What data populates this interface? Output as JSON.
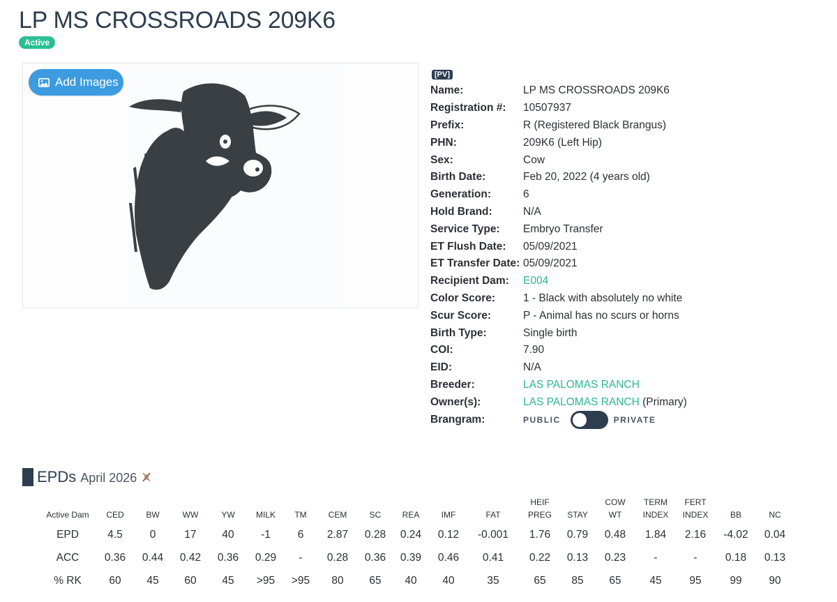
{
  "header": {
    "title": "LP MS CROSSROADS 209K6",
    "status": "Active"
  },
  "photo": {
    "add_images_label": "Add Images"
  },
  "pv_tag": "[PV]",
  "details": [
    {
      "label": "Name:",
      "value": "LP MS CROSSROADS 209K6"
    },
    {
      "label": "Registration #:",
      "value": "10507937"
    },
    {
      "label": "Prefix:",
      "value": "R (Registered Black Brangus)"
    },
    {
      "label": "PHN:",
      "value": "209K6 (Left Hip)"
    },
    {
      "label": "Sex:",
      "value": "Cow"
    },
    {
      "label": "Birth Date:",
      "value": "Feb 20, 2022 (4 years old)"
    },
    {
      "label": "Generation:",
      "value": "6"
    },
    {
      "label": "Hold Brand:",
      "value": "N/A"
    },
    {
      "label": "Service Type:",
      "value": "Embryo Transfer"
    },
    {
      "label": "ET Flush Date:",
      "value": "05/09/2021"
    },
    {
      "label": "ET Transfer Date:",
      "value": "05/09/2021"
    },
    {
      "label": "Recipient Dam:",
      "value": "E004"
    },
    {
      "label": "Color Score:",
      "value": "1 - Black with absolutely no white"
    },
    {
      "label": "Scur Score:",
      "value": "P - Animal has no scurs or horns"
    },
    {
      "label": "Birth Type:",
      "value": "Single birth"
    },
    {
      "label": "COI:",
      "value": "7.90"
    },
    {
      "label": "EID:",
      "value": "N/A"
    },
    {
      "label": "Breeder:",
      "value": "LAS PALOMAS RANCH"
    },
    {
      "label": "Owner(s):",
      "value": "LAS PALOMAS RANCH",
      "suffix": " (Primary)"
    },
    {
      "label": "Brangram:",
      "public": "PUBLIC",
      "private": "PRIVATE"
    }
  ],
  "epds": {
    "title": "EPDs",
    "date": "April 2026",
    "columns": [
      "Active Dam",
      "CED",
      "BW",
      "WW",
      "YW",
      "MILK",
      "TM",
      "CEM",
      "SC",
      "REA",
      "IMF",
      "FAT",
      "HEIF\nPREG",
      "STAY",
      "COW\nWT",
      "TERM\nINDEX",
      "FERT\nINDEX",
      "BB",
      "NC"
    ],
    "rows": [
      [
        "EPD",
        "4.5",
        "0",
        "17",
        "40",
        "-1",
        "6",
        "2.87",
        "0.28",
        "0.24",
        "0.12",
        "-0.001",
        "1.76",
        "0.79",
        "0.48",
        "1.84",
        "2.16",
        "-4.02",
        "0.04"
      ],
      [
        "ACC",
        "0.36",
        "0.44",
        "0.42",
        "0.36",
        "0.29",
        "-",
        "0.28",
        "0.36",
        "0.39",
        "0.46",
        "0.41",
        "0.22",
        "0.13",
        "0.23",
        "-",
        "-",
        "0.18",
        "0.13"
      ],
      [
        "% RK",
        "60",
        "45",
        "60",
        "45",
        ">95",
        ">95",
        "80",
        "65",
        "40",
        "40",
        "35",
        "65",
        "85",
        "65",
        "45",
        "95",
        "99",
        "90"
      ]
    ]
  },
  "colors": {
    "accent": "#2bb594",
    "navy": "#2c3e50",
    "button_blue": "#3d9be0"
  }
}
